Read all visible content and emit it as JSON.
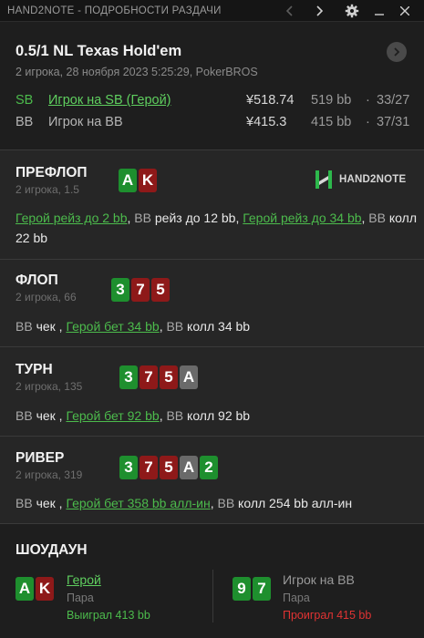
{
  "window": {
    "title": "HAND2NOTE - ПОДРОБНОСТИ РАЗДАЧИ"
  },
  "hand": {
    "title": "0.5/1 NL Texas Hold'em",
    "subtitle": "2 игрока, 28 ноября 2023 5:25:29, PokerBROS",
    "players": [
      {
        "position": "SB",
        "name": "Игрок на SB (Герой)",
        "stack": "¥518.74",
        "bb": "519 bb",
        "sep": "·",
        "ratio": "33/27"
      },
      {
        "position": "BB",
        "name": "Игрок на BB",
        "stack": "¥415.3",
        "bb": "415 bb",
        "sep": "·",
        "ratio": "37/31"
      }
    ]
  },
  "logo": {
    "text": "HAND2NOTE"
  },
  "streets": {
    "preflop": {
      "title": "ПРЕФЛОП",
      "subtitle": "2 игрока, 1.5",
      "cards": [
        {
          "rank": "A",
          "color": "green"
        },
        {
          "rank": "K",
          "color": "red"
        }
      ],
      "actions": [
        {
          "text": "Герой рейз до 2 bb",
          "style": "hero"
        },
        {
          "text": ", ",
          "style": "plain"
        },
        {
          "text": "BB",
          "style": "bb"
        },
        {
          "text": " рейз до 12 bb, ",
          "style": "plain"
        },
        {
          "text": "Герой рейз до 34 bb",
          "style": "hero"
        },
        {
          "text": ",",
          "style": "plain"
        },
        {
          "text": " BB",
          "style": "bb"
        },
        {
          "text": " колл 22 bb",
          "style": "plain"
        }
      ]
    },
    "flop": {
      "title": "ФЛОП",
      "subtitle": "2 игрока, 66",
      "cards": [
        {
          "rank": "3",
          "color": "green"
        },
        {
          "rank": "7",
          "color": "red"
        },
        {
          "rank": "5",
          "color": "red"
        }
      ],
      "actions": [
        {
          "text": "BB",
          "style": "bb"
        },
        {
          "text": " чек , ",
          "style": "plain"
        },
        {
          "text": "Герой бет 34 bb",
          "style": "hero"
        },
        {
          "text": ", ",
          "style": "plain"
        },
        {
          "text": "BB",
          "style": "bb"
        },
        {
          "text": " колл 34 bb",
          "style": "plain"
        }
      ]
    },
    "turn": {
      "title": "ТУРН",
      "subtitle": "2 игрока, 135",
      "cards": [
        {
          "rank": "3",
          "color": "green"
        },
        {
          "rank": "7",
          "color": "red"
        },
        {
          "rank": "5",
          "color": "red"
        },
        {
          "rank": "A",
          "color": "gray"
        }
      ],
      "actions": [
        {
          "text": "BB",
          "style": "bb"
        },
        {
          "text": " чек , ",
          "style": "plain"
        },
        {
          "text": "Герой бет 92 bb",
          "style": "hero"
        },
        {
          "text": ", ",
          "style": "plain"
        },
        {
          "text": "BB",
          "style": "bb"
        },
        {
          "text": " колл 92 bb",
          "style": "plain"
        }
      ]
    },
    "river": {
      "title": "РИВЕР",
      "subtitle": "2 игрока, 319",
      "cards": [
        {
          "rank": "3",
          "color": "green"
        },
        {
          "rank": "7",
          "color": "red"
        },
        {
          "rank": "5",
          "color": "red"
        },
        {
          "rank": "A",
          "color": "gray"
        },
        {
          "rank": "2",
          "color": "green"
        }
      ],
      "actions": [
        {
          "text": "BB",
          "style": "bb"
        },
        {
          "text": " чек , ",
          "style": "plain"
        },
        {
          "text": "Герой бет 358 bb алл-ин",
          "style": "hero"
        },
        {
          "text": ", ",
          "style": "plain"
        },
        {
          "text": "BB",
          "style": "bb"
        },
        {
          "text": " колл 254 bb алл-ин",
          "style": "plain"
        }
      ]
    }
  },
  "showdown": {
    "title": "ШОУДАУН",
    "hero": {
      "name": "Герой",
      "hand": "Пара",
      "result": "Выиграл 413 bb",
      "cards": [
        {
          "rank": "A",
          "color": "green"
        },
        {
          "rank": "K",
          "color": "red"
        }
      ]
    },
    "villain": {
      "name": "Игрок на BB",
      "hand": "Пара",
      "result": "Проиграл 415 bb",
      "cards": [
        {
          "rank": "9",
          "color": "green"
        },
        {
          "rank": "7",
          "color": "green"
        }
      ]
    }
  },
  "colors": {
    "hero": "#4cbb4c",
    "card_green": "#1e8f2e",
    "card_red": "#8e1919",
    "card_gray": "#6a6a6a",
    "lose": "#e03333"
  },
  "icons": {
    "back": "chevron-left-icon",
    "forward": "chevron-right-icon",
    "settings": "gear-icon",
    "minimize": "minimize-icon",
    "close": "close-icon",
    "next": "chevron-right-icon"
  }
}
